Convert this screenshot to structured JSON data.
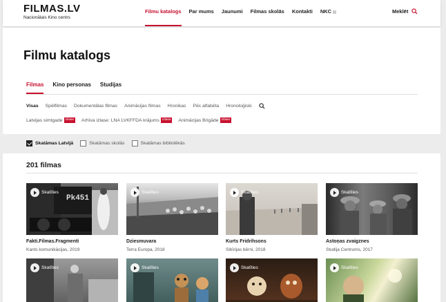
{
  "header": {
    "logo_main": "FILMAS.LV",
    "logo_sub": "Nacionālais Kino centrs",
    "nav": [
      "Filmu katalogs",
      "Par mums",
      "Jaunumi",
      "Filmas skolās",
      "Kontakti",
      "NKC"
    ],
    "search_label": "Meklēt"
  },
  "page_title": "Filmu katalogs",
  "tabs": [
    "Filmas",
    "Kino personas",
    "Studijas"
  ],
  "filters": [
    "Visas",
    "Spēlfilmas",
    "Dokumentālas filmas",
    "Animācijas filmas",
    "Hronikas",
    "Pēc alfabēta",
    "Hronoloģiski"
  ],
  "tags": [
    {
      "label": "Latvijas simtgade",
      "badge": "Izlase"
    },
    {
      "label": "Arhīva izlase: LNA LVKFFDA krājums",
      "badge": "Izlase"
    },
    {
      "label": "Animācijas Brigāde",
      "badge": "Izlase"
    }
  ],
  "checkboxes": [
    {
      "label": "Skatāmas Latvijā",
      "checked": true
    },
    {
      "label": "Skatāmas skolās",
      "checked": false
    },
    {
      "label": "Skatāmas bibliotēkās",
      "checked": false
    }
  ],
  "result_count": "201 filmas",
  "watch_label": "Skatīties",
  "cards": [
    {
      "title": "Fakti.Filmas.Fragmenti",
      "meta": "Kants komunikācijas, 2019",
      "overlay": "Pk451"
    },
    {
      "title": "Dziesmuvara",
      "meta": "Terra Europa, 2018"
    },
    {
      "title": "Kurts Fridrihsons",
      "meta": "Sibīrijas bērni, 2018"
    },
    {
      "title": "Astoņas zvaigznes",
      "meta": "Studija Centrums, 2017"
    }
  ],
  "colors": {
    "accent": "#c8102e"
  }
}
